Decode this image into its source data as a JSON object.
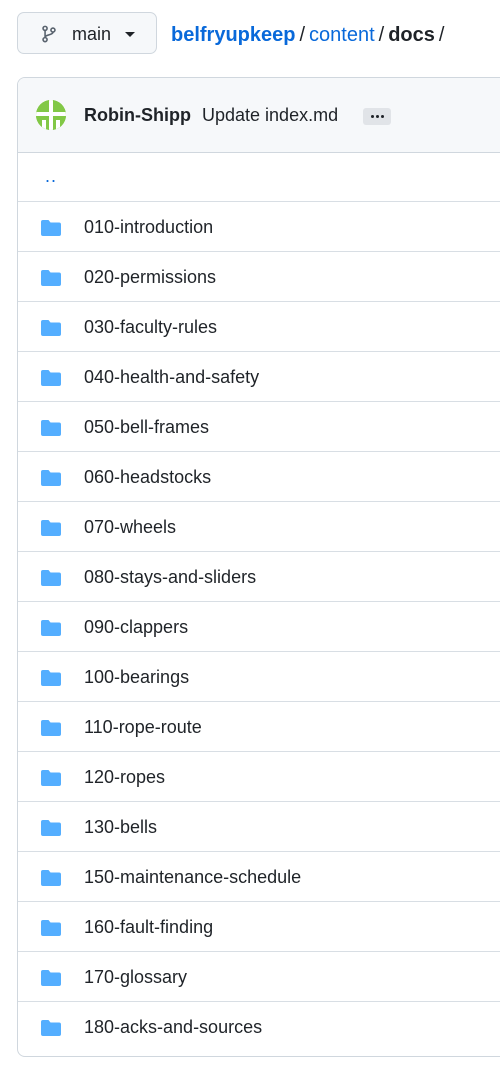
{
  "branch": {
    "label": "main",
    "icon": "git-branch-icon"
  },
  "breadcrumb": {
    "repo": "belfryupkeep",
    "separator": "/",
    "path": [
      "content"
    ],
    "current": "docs",
    "trailing": "/"
  },
  "commit": {
    "author": "Robin-Shipp",
    "message": "Update index.md",
    "more": "..."
  },
  "parent_dir": "..",
  "folders": [
    "010-introduction",
    "020-permissions",
    "030-faculty-rules",
    "040-health-and-safety",
    "050-bell-frames",
    "060-headstocks",
    "070-wheels",
    "080-stays-and-sliders",
    "090-clappers",
    "100-bearings",
    "110-rope-route",
    "120-ropes",
    "130-bells",
    "150-maintenance-schedule",
    "160-fault-finding",
    "170-glossary",
    "180-acks-and-sources"
  ],
  "colors": {
    "link": "#0969da",
    "folder": "#54aeff",
    "avatar": "#82c846",
    "border": "#d0d7de"
  }
}
